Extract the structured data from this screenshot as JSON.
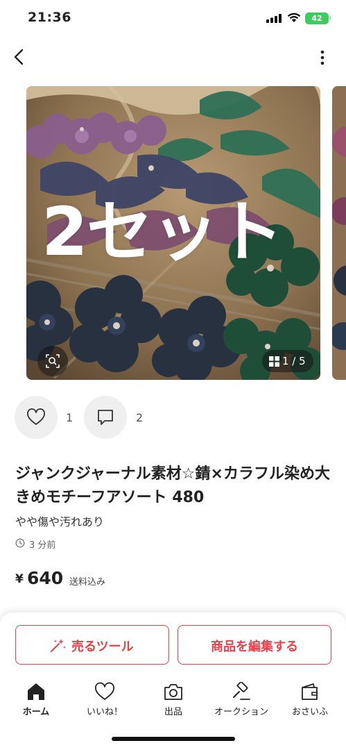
{
  "status_bar": {
    "time": "21:36",
    "battery": "42"
  },
  "carousel": {
    "overlay_text": "2セット",
    "counter": "1 / 5",
    "current_page": 1,
    "total_pages": 5
  },
  "actions": {
    "like_count": "1",
    "comment_count": "2"
  },
  "product": {
    "title": "ジャンクジャーナル素材☆錆×カラフル染め大きめモチーフアソート 480",
    "condition": "やや傷や汚れあり",
    "posted": "3 分前",
    "currency": "¥",
    "price": "640",
    "shipping": "送料込み"
  },
  "buttons": {
    "sell_tool": "売るツール",
    "edit": "商品を編集する"
  },
  "tabs": [
    {
      "label": "ホーム",
      "icon": "home-icon"
    },
    {
      "label": "いいね！",
      "icon": "heart-icon"
    },
    {
      "label": "出品",
      "icon": "camera-icon"
    },
    {
      "label": "オークション",
      "icon": "gavel-icon"
    },
    {
      "label": "おさいふ",
      "icon": "wallet-icon"
    }
  ],
  "colors": {
    "accent": "#e8414a",
    "battery": "#3fcb5f",
    "text": "#222222"
  }
}
